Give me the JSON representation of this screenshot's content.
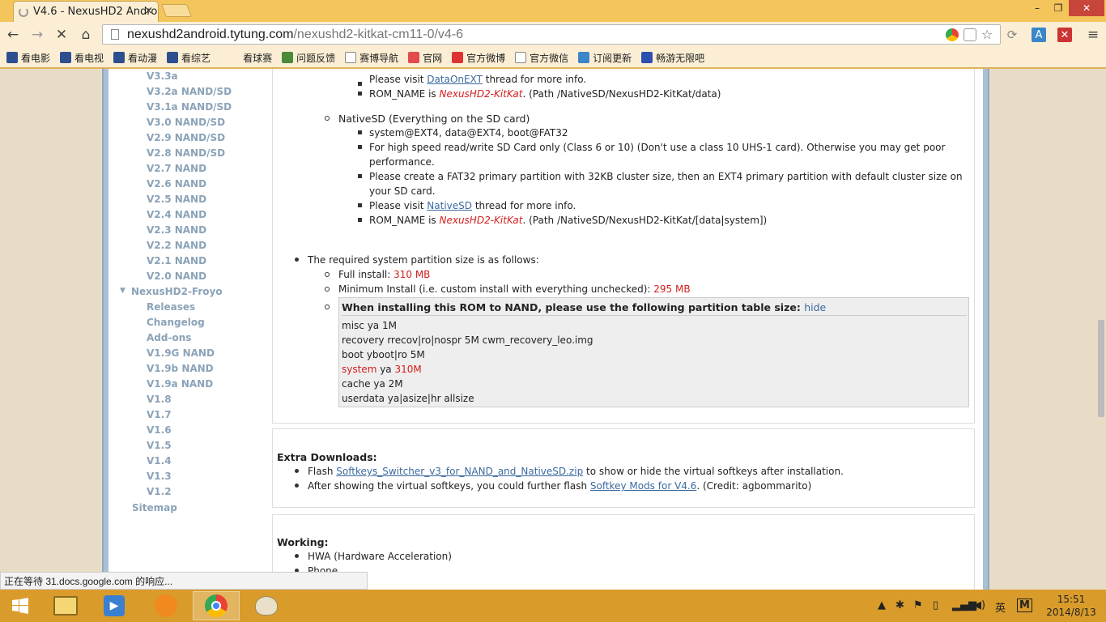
{
  "browser": {
    "tab_title": "V4.6 - NexusHD2 Andro",
    "tab_close": "×",
    "url_host": "nexushd2android.tytung.com",
    "url_path": "/nexushd2-kitkat-cm11-0/v4-6",
    "window_min": "–",
    "window_max": "❐",
    "window_close": "✕",
    "back_icon": "←",
    "forward_icon": "→",
    "stop_icon": "✕",
    "home_icon": "⌂",
    "star_icon": "☆",
    "menu_icon": "≡"
  },
  "bookmarks": [
    {
      "label": "看电影",
      "icon": "bookmark-movie-icon",
      "color": "#2d4f8f"
    },
    {
      "label": "看电视",
      "icon": "bookmark-tv-icon",
      "color": "#2d4f8f"
    },
    {
      "label": "看动漫",
      "icon": "bookmark-anime-icon",
      "color": "#2d4f8f"
    },
    {
      "label": "看综艺",
      "icon": "bookmark-variety-icon",
      "color": "#2d4f8f"
    },
    {
      "label": "看球赛",
      "icon": "bookmark-sports-icon",
      "color": "#fbeed4"
    },
    {
      "label": "问题反馈",
      "icon": "feedback-icon",
      "color": "#4a8a3a"
    },
    {
      "label": "赛博导航",
      "icon": "page-icon",
      "color": "#ffffff"
    },
    {
      "label": "官网",
      "icon": "site-icon",
      "color": "#e24c4c"
    },
    {
      "label": "官方微博",
      "icon": "weibo-icon",
      "color": "#d33"
    },
    {
      "label": "官方微信",
      "icon": "page-icon",
      "color": "#ffffff"
    },
    {
      "label": "订阅更新",
      "icon": "subscribe-icon",
      "color": "#3a86c8"
    },
    {
      "label": "畅游无限吧",
      "icon": "baidu-paw-icon",
      "color": "#2d4fb0"
    }
  ],
  "sidebar": {
    "items": [
      {
        "label": "V3.3a",
        "indent": 2
      },
      {
        "label": "V3.2a NAND/SD",
        "indent": 2
      },
      {
        "label": "V3.1a NAND/SD",
        "indent": 2
      },
      {
        "label": "V3.0 NAND/SD",
        "indent": 2
      },
      {
        "label": "V2.9 NAND/SD",
        "indent": 2
      },
      {
        "label": "V2.8 NAND/SD",
        "indent": 2
      },
      {
        "label": "V2.7 NAND",
        "indent": 2
      },
      {
        "label": "V2.6 NAND",
        "indent": 2
      },
      {
        "label": "V2.5 NAND",
        "indent": 2
      },
      {
        "label": "V2.4 NAND",
        "indent": 2
      },
      {
        "label": "V2.3 NAND",
        "indent": 2
      },
      {
        "label": "V2.2 NAND",
        "indent": 2
      },
      {
        "label": "V2.1 NAND",
        "indent": 2
      },
      {
        "label": "V2.0 NAND",
        "indent": 2
      },
      {
        "label": "NexusHD2-Froyo",
        "indent": 1
      },
      {
        "label": "Releases",
        "indent": 2
      },
      {
        "label": "Changelog",
        "indent": 2
      },
      {
        "label": "Add-ons",
        "indent": 2
      },
      {
        "label": "V1.9G NAND",
        "indent": 2
      },
      {
        "label": "V1.9b NAND",
        "indent": 2
      },
      {
        "label": "V1.9a NAND",
        "indent": 2
      },
      {
        "label": "V1.8",
        "indent": 2
      },
      {
        "label": "V1.7",
        "indent": 2
      },
      {
        "label": "V1.6",
        "indent": 2
      },
      {
        "label": "V1.5",
        "indent": 2
      },
      {
        "label": "V1.4",
        "indent": 2
      },
      {
        "label": "V1.3",
        "indent": 2
      },
      {
        "label": "V1.2",
        "indent": 2
      },
      {
        "label": "Sitemap",
        "indent": 0
      }
    ],
    "collapse_icon": "▼"
  },
  "content": {
    "dataonext_prefix": "Please visit ",
    "dataonext_link": "DataOnEXT",
    "dataonext_suffix": " thread for more info.",
    "romname1_prefix": "ROM_NAME is ",
    "romname1_value": "NexusHD2-KitKat",
    "romname1_suffix": ". (Path /NativeSD/NexusHD2-KitKat/data)",
    "nativesd_heading": "NativeSD (Everything on the SD card)",
    "nativesd_items": {
      "i1": "system@EXT4, data@EXT4, boot@FAT32",
      "i2a": "For high speed read/write SD Card only (Class 6 or 10) (Don't use a class 10 UHS-1 card). Otherwise you may get poor",
      "i2b": "performance.",
      "i3a": "Please create a FAT32 primary partition with 32KB cluster size, then an EXT4 primary partition with default cluster size on",
      "i3b": "your SD card.",
      "i4_prefix": "Please visit ",
      "i4_link": "NativeSD",
      "i4_suffix": " thread for more info.",
      "i5_prefix": "ROM_NAME is ",
      "i5_value": "NexusHD2-KitKat",
      "i5_suffix": ". (Path /NativeSD/NexusHD2-KitKat/[data|system])"
    },
    "partition_intro": "The required system partition size is as follows:",
    "full_install_label": "Full install: ",
    "full_install_value": "310 MB",
    "min_install_label": "Minimum Install (i.e. custom install with everything unchecked): ",
    "min_install_value": "295 MB",
    "partbox_title": "When installing this ROM to NAND, please use the following partition table size: ",
    "partbox_hide": "hide",
    "partbox_lines": {
      "l1": "misc ya 1M",
      "l2": "recovery rrecov|ro|nospr 5M cwm_recovery_leo.img",
      "l3": "boot yboot|ro 5M",
      "l4a": "system",
      "l4b": " ya ",
      "l4c": "310M",
      "l5": "cache ya 2M",
      "l6": "userdata ya|asize|hr allsize"
    },
    "extra_heading": "Extra Downloads:",
    "extra1_prefix": "Flash ",
    "extra1_link": "Softkeys_Switcher_v3_for_NAND_and_NativeSD.zip",
    "extra1_suffix": " to show or hide the virtual softkeys after installation.",
    "extra2_prefix": "After showing the virtual softkeys, you could further flash ",
    "extra2_link": "Softkey Mods for V4.6",
    "extra2_suffix": ". (Credit: agbommarito)",
    "working_heading": "Working:",
    "working1": "HWA (Hardware Acceleration)",
    "working2": "Phone"
  },
  "status_text": "正在等待 31.docs.google.com 的响应...",
  "taskbar": {
    "apps": [
      "file-explorer-icon",
      "media-player-icon",
      "uc-browser-icon",
      "chrome-icon",
      "paint-icon"
    ],
    "tray": {
      "ime_label": "英",
      "ime_mode": "M"
    },
    "time": "15:51",
    "date": "2014/8/13"
  },
  "colors": {
    "accent_red": "#d21e1e",
    "link_blue": "#3b6aa0",
    "sidebar_text": "#8ba3b8",
    "taskbar": "#d99c2b"
  }
}
